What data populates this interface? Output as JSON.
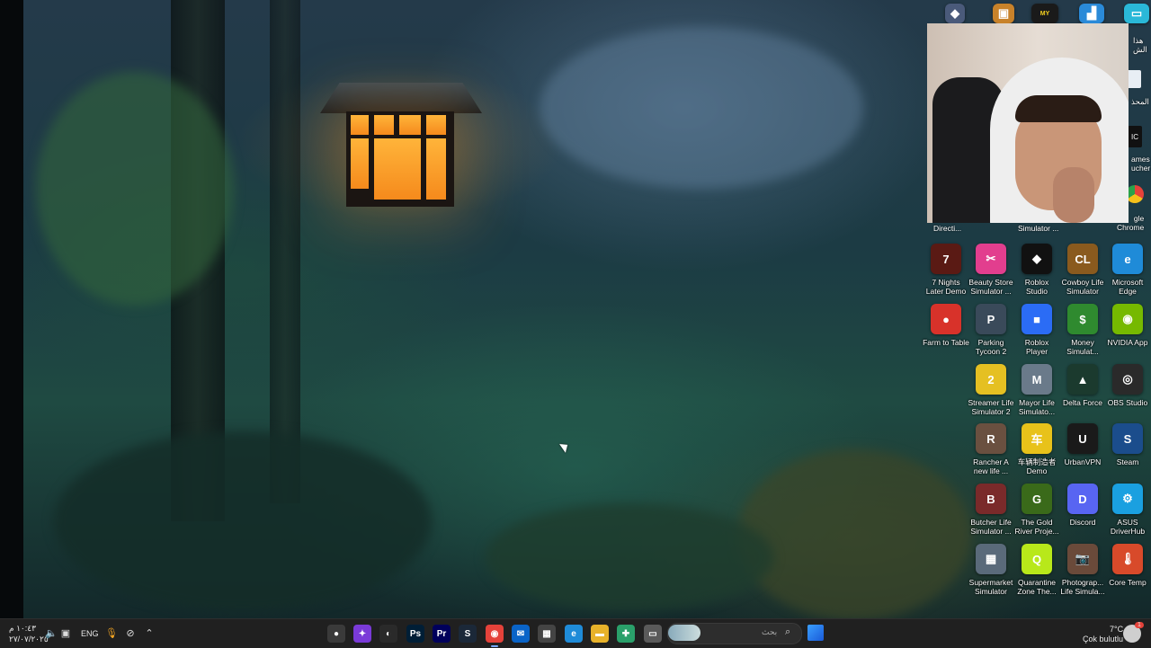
{
  "desktop": {
    "icons": [
      {
        "label": "7 Nights\nLater Demo",
        "icon": "horror-game-icon",
        "color": "#5a1a14",
        "glyph": "7"
      },
      {
        "label": "Beauty Store\nSimulator ...",
        "icon": "hair-dryer-icon",
        "color": "#e23e8e",
        "glyph": "✂"
      },
      {
        "label": "Roblox\nStudio",
        "icon": "roblox-studio-icon",
        "color": "#111111",
        "glyph": "◆"
      },
      {
        "label": "Cowboy Life\nSimulator",
        "icon": "cowboy-game-icon",
        "color": "#8a5a1e",
        "glyph": "CL"
      },
      {
        "label": "Microsoft\nEdge",
        "icon": "edge-icon",
        "color": "#1f8bd8",
        "glyph": "e"
      },
      {
        "label": "Farm to Table",
        "icon": "tomato-icon",
        "color": "#d8322a",
        "glyph": "●"
      },
      {
        "label": "Parking\nTycoon 2",
        "icon": "parking-game-icon",
        "color": "#3a4a5a",
        "glyph": "P"
      },
      {
        "label": "Roblox Player",
        "icon": "roblox-player-icon",
        "color": "#2b6cf5",
        "glyph": "■"
      },
      {
        "label": "Money\nSimulat...",
        "icon": "money-game-icon",
        "color": "#2f8a2f",
        "glyph": "$"
      },
      {
        "label": "NVIDIA App",
        "icon": "nvidia-icon",
        "color": "#76b900",
        "glyph": "◉"
      },
      {
        "label": "Streamer Life\nSimulator 2",
        "icon": "streamer-game-icon",
        "color": "#e5c022",
        "glyph": "2"
      },
      {
        "label": "Mayor Life\nSimulato...",
        "icon": "mayor-game-icon",
        "color": "#6a7a8a",
        "glyph": "M"
      },
      {
        "label": "Delta Force",
        "icon": "delta-force-icon",
        "color": "#1b3a2e",
        "glyph": "▲"
      },
      {
        "label": "OBS Studio",
        "icon": "obs-icon",
        "color": "#2a2a2a",
        "glyph": "◎"
      },
      {
        "label": "Rancher A\nnew life ...",
        "icon": "rancher-game-icon",
        "color": "#6a5040",
        "glyph": "R"
      },
      {
        "label": "车辆制造者\nDemo",
        "icon": "car-game-icon",
        "color": "#e8c21a",
        "glyph": "车"
      },
      {
        "label": "UrbanVPN",
        "icon": "vpn-icon",
        "color": "#1a1a1a",
        "glyph": "U"
      },
      {
        "label": "Steam",
        "icon": "steam-icon",
        "color": "#1b4d8c",
        "glyph": "S"
      },
      {
        "label": "Butcher Life\nSimulator ...",
        "icon": "butcher-game-icon",
        "color": "#7a2a2a",
        "glyph": "B"
      },
      {
        "label": "The Gold\nRiver Proje...",
        "icon": "gold-river-icon",
        "color": "#3a6a1a",
        "glyph": "G"
      },
      {
        "label": "Discord",
        "icon": "discord-icon",
        "color": "#5865f2",
        "glyph": "D"
      },
      {
        "label": "ASUS\nDriverHub",
        "icon": "asus-gear-icon",
        "color": "#1aa0e0",
        "glyph": "⚙"
      },
      {
        "label": "Supermarket\nSimulator",
        "icon": "supermarket-icon",
        "color": "#5a6a7a",
        "glyph": "▦"
      },
      {
        "label": "Quarantine\nZone The...",
        "icon": "quarantine-icon",
        "color": "#b8e81a",
        "glyph": "Q"
      },
      {
        "label": "Photograp...\nLife Simula...",
        "icon": "camera-game-icon",
        "color": "#6a4a3a",
        "glyph": "📷"
      },
      {
        "label": "Core Temp",
        "icon": "thermometer-icon",
        "color": "#d84a2a",
        "glyph": "🌡"
      }
    ],
    "partial_labels": {
      "directi": "Directi...",
      "simulator": "Simulator ...",
      "chrome": "gle\nChrome",
      "games": "ames\nucher"
    }
  },
  "taskbar": {
    "clock_time": "١٠:٤٣ م",
    "clock_date": "٢٧/٠٧/٢٠٢٥",
    "language": "ENG",
    "search_placeholder": "بحث",
    "weather_temp": "7°C",
    "weather_text": "Çok bulutlu",
    "notification_count": "1",
    "apps": [
      {
        "name": "taskbar-app-1",
        "icon": "app-icon",
        "color": "#3a3a3a",
        "glyph": "●"
      },
      {
        "name": "taskbar-app-2",
        "icon": "purple-app-icon",
        "color": "#7a3ad8",
        "glyph": "✦"
      },
      {
        "name": "taskbar-app-3",
        "icon": "github-icon",
        "color": "#2a2a2a",
        "glyph": "◐"
      },
      {
        "name": "taskbar-photoshop",
        "icon": "photoshop-icon",
        "color": "#001e36",
        "glyph": "Ps"
      },
      {
        "name": "taskbar-premiere",
        "icon": "premiere-icon",
        "color": "#00005b",
        "glyph": "Pr"
      },
      {
        "name": "taskbar-steam",
        "icon": "steam-icon",
        "color": "#1b2838",
        "glyph": "S"
      },
      {
        "name": "taskbar-chrome",
        "icon": "chrome-icon",
        "color": "#e5423a",
        "glyph": "◉"
      },
      {
        "name": "taskbar-outlook",
        "icon": "mail-icon",
        "color": "#0a64c8",
        "glyph": "✉"
      },
      {
        "name": "taskbar-store",
        "icon": "store-icon",
        "color": "#444444",
        "glyph": "▦"
      },
      {
        "name": "taskbar-edge",
        "icon": "edge-icon",
        "color": "#1f8bd8",
        "glyph": "e"
      },
      {
        "name": "taskbar-explorer",
        "icon": "folder-icon",
        "color": "#e8b22a",
        "glyph": "▬"
      },
      {
        "name": "taskbar-app-4",
        "icon": "colorful-app-icon",
        "color": "#2aa06a",
        "glyph": "✚"
      },
      {
        "name": "taskbar-app-5",
        "icon": "window-icon",
        "color": "#5a5a5a",
        "glyph": "▭"
      }
    ]
  }
}
